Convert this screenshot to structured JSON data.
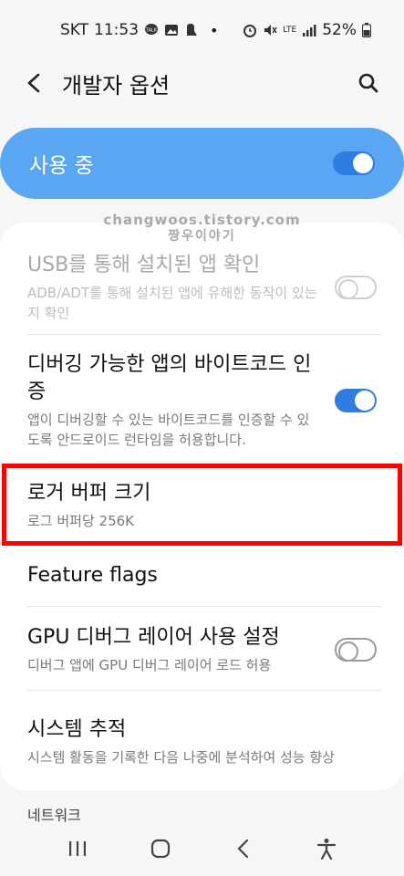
{
  "status_bar": {
    "carrier": "SKT",
    "time": "11:53",
    "battery": "52%",
    "network": "LTE"
  },
  "header": {
    "title": "개발자 옵션"
  },
  "master_switch": {
    "label": "사용 중",
    "on": true
  },
  "watermark": {
    "line1": "changwoos.tistory.com",
    "line2": "짱우이야기"
  },
  "items": [
    {
      "title": "USB를 통해 설치된 앱 확인",
      "subtitle": "ADB/ADT를 통해 설치된 앱에 유해한 동작이 있는지 확인",
      "toggle": "off",
      "disabled": true
    },
    {
      "title": "디버깅 가능한 앱의 바이트코드 인증",
      "subtitle": "앱이 디버깅할 수 있는 바이트코드를 인증할 수 있도록 안드로이드 런타임을 허용합니다.",
      "toggle": "on",
      "disabled": false
    },
    {
      "title": "로거 버퍼 크기",
      "subtitle": "로그 버퍼당 256K",
      "toggle": null,
      "disabled": false
    },
    {
      "title": "Feature flags",
      "subtitle": "",
      "toggle": null,
      "disabled": false
    },
    {
      "title": "GPU 디버그 레이어 사용 설정",
      "subtitle": "디버그 앱에 GPU 디버그 레이어 로드 허용",
      "toggle": "off",
      "disabled": false
    },
    {
      "title": "시스템 추적",
      "subtitle": "시스템 활동을 기록한 다음 나중에 분석하여 성능 향상",
      "toggle": null,
      "disabled": false
    }
  ],
  "section_label": "네트워크",
  "colors": {
    "accent": "#2f7ce3",
    "master_bg": "#5aa6f2",
    "highlight": "#ff0000"
  },
  "icons": {
    "back": "back-arrow-icon",
    "search": "search-icon",
    "recents": "recents-icon",
    "home": "home-icon",
    "nav_back": "nav-back-icon",
    "accessibility": "accessibility-icon"
  }
}
